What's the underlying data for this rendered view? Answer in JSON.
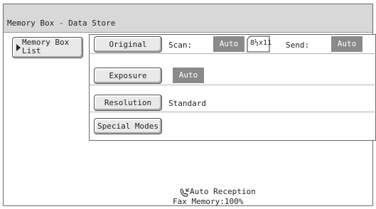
{
  "window": {
    "title": "Memory Box - Data Store"
  },
  "sidebar": {
    "memory_box_list_label": "Memory Box List"
  },
  "settings": {
    "original": {
      "button_label": "Original",
      "scan_label": "Scan:",
      "scan_value": "Auto",
      "paper_size": "8½x11",
      "send_label": "Send:",
      "send_value": "Auto"
    },
    "exposure": {
      "button_label": "Exposure",
      "value": "Auto"
    },
    "resolution": {
      "button_label": "Resolution",
      "value": "Standard"
    },
    "special_modes": {
      "button_label": "Special Modes"
    }
  },
  "status": {
    "reception_mode": "Auto Reception",
    "fax_memory": "Fax Memory:100%",
    "icons": {
      "reception": "phone-reception-icon",
      "paper": "paper-size-icon",
      "arrow": "triangle-right-icon"
    }
  },
  "colors": {
    "title_bar": "#d8d8d8",
    "value_box": "#8a8a8a",
    "button_face": "#e9e9e9"
  }
}
